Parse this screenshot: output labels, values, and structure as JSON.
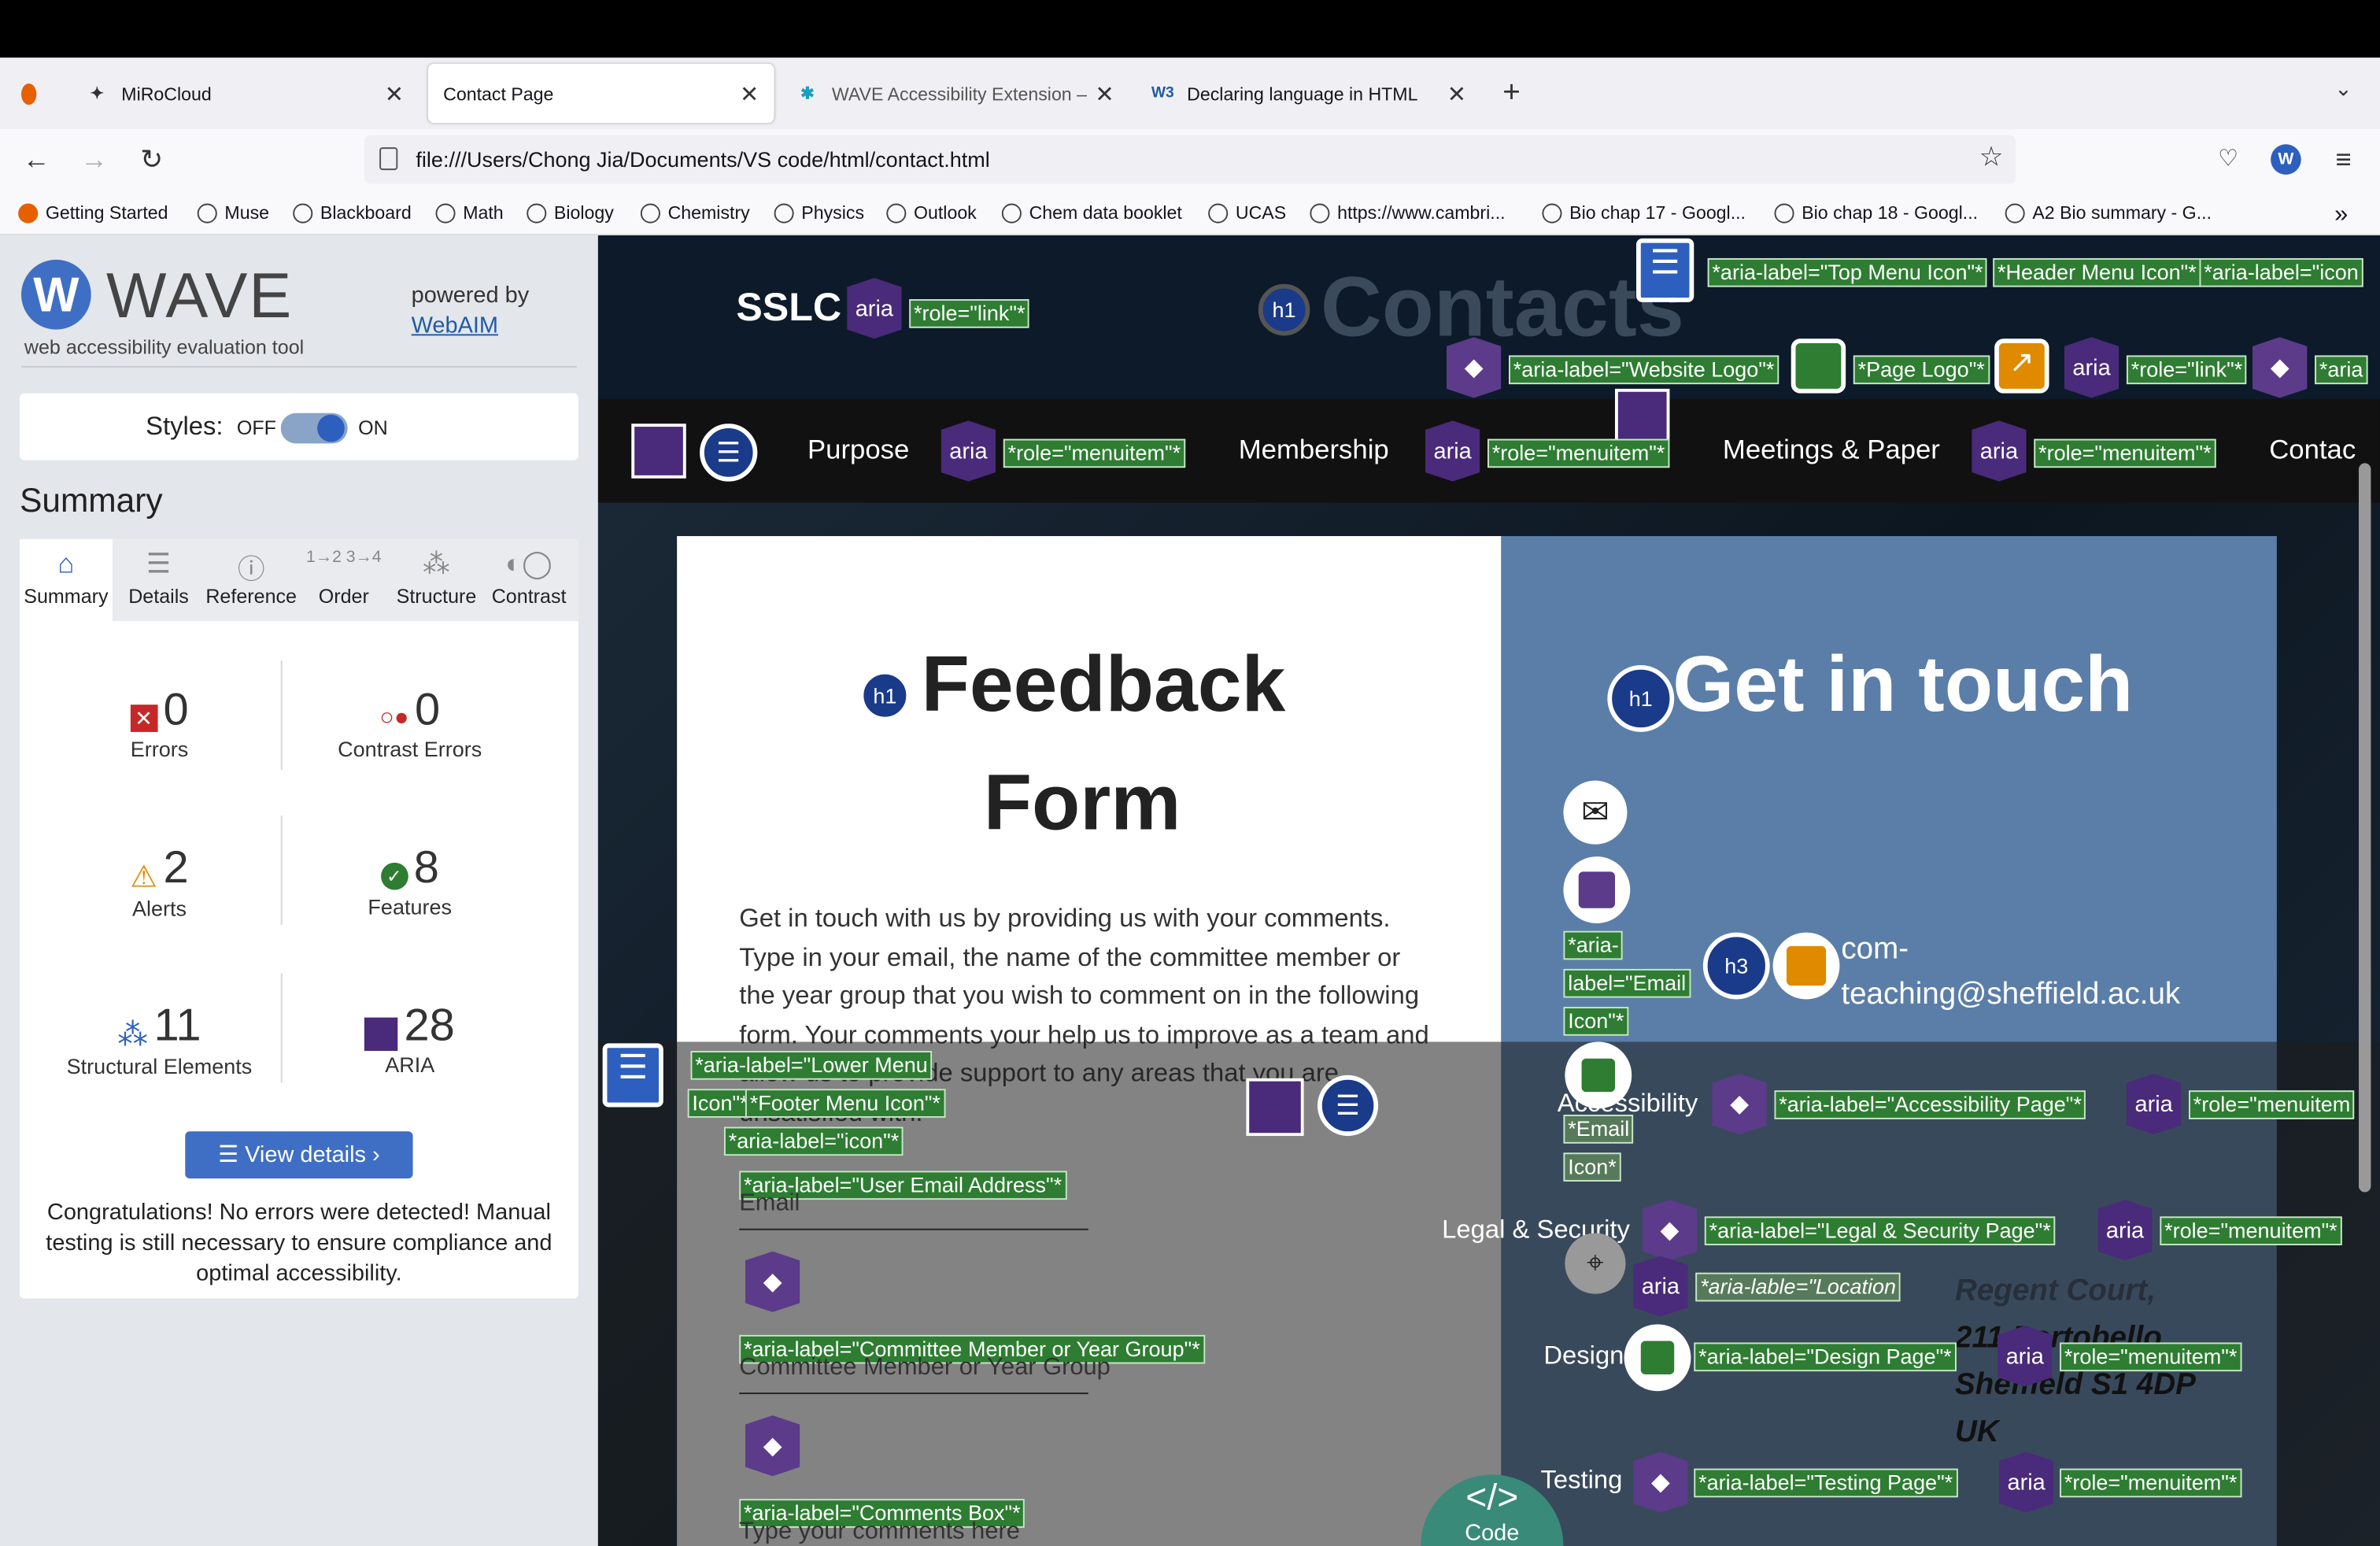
{
  "browser": {
    "tabs": [
      {
        "label": "MiRoCloud"
      },
      {
        "label": "Contact Page"
      },
      {
        "label": "WAVE Accessibility Extension – "
      },
      {
        "label": "Declaring language in HTML"
      }
    ],
    "url": "file:///Users/Chong Jia/Documents/VS code/html/contact.html",
    "bookmarks": [
      "Getting Started",
      "Muse",
      "Blackboard",
      "Math",
      "Biology",
      "Chemistry",
      "Physics",
      "Outlook",
      "Chem data booklet",
      "UCAS",
      "https://www.cambri...",
      "Bio chap 17 - Googl...",
      "Bio chap 18 - Googl...",
      "A2 Bio summary - G..."
    ]
  },
  "wave": {
    "logo": "WAVE",
    "tagline": "web accessibility evaluation tool",
    "powered_by": "powered by",
    "webaim": "WebAIM",
    "styles_label": "Styles:",
    "off": "OFF",
    "on": "ON",
    "summary_heading": "Summary",
    "tabs": [
      "Summary",
      "Details",
      "Reference",
      "Order",
      "Structure",
      "Contrast"
    ],
    "stats": {
      "errors": {
        "num": "0",
        "label": "Errors"
      },
      "contrast": {
        "num": "0",
        "label": "Contrast Errors"
      },
      "alerts": {
        "num": "2",
        "label": "Alerts"
      },
      "features": {
        "num": "8",
        "label": "Features"
      },
      "structural": {
        "num": "11",
        "label": "Structural Elements"
      },
      "aria": {
        "num": "28",
        "label": "ARIA"
      }
    },
    "view_details": "View details ›",
    "congrats": "Congratulations! No errors were detected! Manual testing is still necessary to ensure compliance and optimal accessibility."
  },
  "page": {
    "brand": "SSLC",
    "contacts_title": "Contacts",
    "nav": [
      "Purpose",
      "Membership",
      "Meetings & Paper",
      "Contac"
    ],
    "feedback_title_1": "Feedback",
    "feedback_title_2": "Form",
    "feedback_text": "Get in touch with us by providing us with your comments. Type in your email, the name of the committee member or the year group that you wish to comment on in the following form. Your comments your help us to improve as a team and allow us to provide support to any areas that you are unsatisfied with.",
    "get_in_touch": "Get in touch",
    "email_1": "com-",
    "email_2": "teaching@sheffield.ac.uk",
    "email_placeholder": "Email",
    "committee_placeholder": "Committee Member or Year Group",
    "comments_placeholder": "Type your comments here",
    "footer_menu": [
      "Accessibility",
      "Legal & Security",
      "Design",
      "Testing"
    ],
    "address": [
      "Regent Court,",
      "211 Portobello",
      "Sheffield S1 4DP",
      "UK"
    ],
    "code_label": "Code",
    "wave_labels": {
      "role_link": "*role=\"link\"*",
      "top_menu": "*aria-label=\"Top Menu Icon\"*",
      "header_menu": "*Header Menu Icon\"*",
      "aria_icon": "*aria-label=\"icon",
      "website_logo": "*aria-label=\"Website Logo\"*",
      "page_logo": "*Page Logo\"*",
      "role_link2": "*role=\"link\"*",
      "aria_trunc": "*aria",
      "role_menuitem": "*role=\"menuitem\"*",
      "lower_menu_1": "*aria-label=\"Lower Menu",
      "lower_menu_2": "Icon\"*",
      "footer_menu_icon": "*Footer Menu Icon\"*",
      "icon_label": "*aria-label=\"icon\"*",
      "user_email": "*aria-label=\"User Email Address\"*",
      "committee": "*aria-label=\"Committee Member or Year Group\"*",
      "comments_box": "*aria-label=\"Comments Box\"*",
      "email_icon_1": "*aria-",
      "email_icon_2": "label=\"Email",
      "email_icon_3": "Icon\"*",
      "email_icon_b1": "*Email",
      "email_icon_b2": "Icon*",
      "accessibility_page": "*aria-label=\"Accessibility Page\"*",
      "role_menuitem_trunc": "*role=\"menuitem",
      "legal_page": "*aria-label=\"Legal & Security Page\"*",
      "location": "*aria-lable=\"Location",
      "design_page": "*aria-label=\"Design Page\"*",
      "testing_page": "*aria-label=\"Testing Page\"*"
    }
  }
}
